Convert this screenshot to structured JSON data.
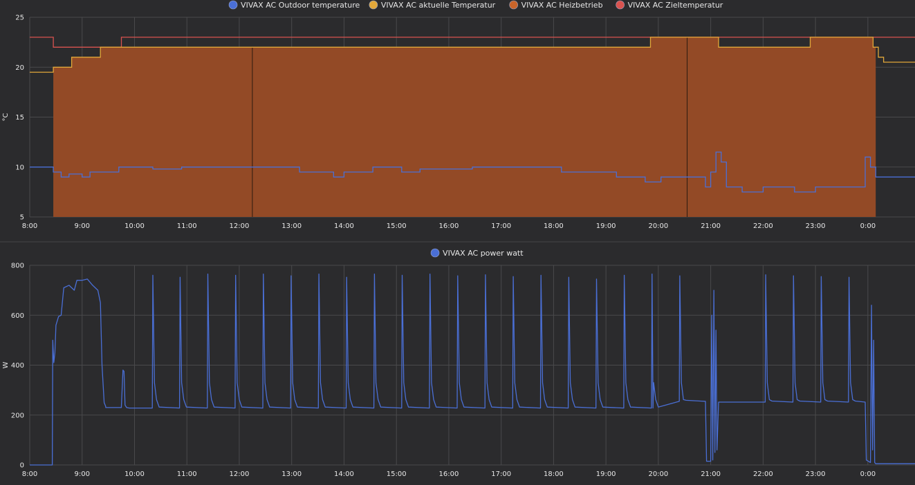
{
  "colors": {
    "outdoor": "#4a6fd6",
    "current": "#e2a83a",
    "heating_fill": "#934a26",
    "heating_line": "#c8642a",
    "target": "#d9534f",
    "power": "#4a6fd6",
    "grid": "#4a4a4c",
    "background": "#2b2b2d",
    "divider": "#444446"
  },
  "x_ticks": [
    "8:00",
    "9:00",
    "10:00",
    "11:00",
    "12:00",
    "13:00",
    "14:00",
    "15:00",
    "16:00",
    "17:00",
    "18:00",
    "19:00",
    "20:00",
    "21:00",
    "22:00",
    "23:00",
    "0:00"
  ],
  "chart_data": [
    {
      "type": "line",
      "ylabel": "°C",
      "ylim": [
        5,
        25
      ],
      "yticks": [
        5,
        10,
        15,
        20,
        25
      ],
      "x_range_hours": [
        8,
        24.9
      ],
      "grid": true,
      "legend_position": "top-center",
      "series": [
        {
          "name": "VIVAX AC Outdoor temperature",
          "key": "outdoor",
          "x": [
            8.0,
            8.45,
            8.45,
            8.6,
            8.6,
            8.75,
            8.75,
            9.0,
            9.0,
            9.15,
            9.15,
            9.45,
            9.45,
            9.7,
            9.7,
            10.35,
            10.35,
            10.9,
            10.9,
            12.25,
            12.25,
            13.15,
            13.15,
            13.8,
            13.8,
            14.0,
            14.0,
            14.55,
            14.55,
            15.1,
            15.1,
            15.45,
            15.45,
            16.45,
            16.45,
            17.4,
            17.4,
            18.15,
            18.15,
            19.2,
            19.2,
            19.75,
            19.75,
            20.05,
            20.05,
            20.9,
            20.9,
            21.0,
            21.0,
            21.1,
            21.1,
            21.2,
            21.2,
            21.3,
            21.3,
            21.6,
            21.6,
            22.0,
            22.0,
            22.15,
            22.15,
            22.6,
            22.6,
            23.0,
            23.0,
            23.4,
            23.4,
            23.95,
            23.95,
            24.05,
            24.05,
            24.15,
            24.15,
            24.9
          ],
          "y": [
            10.0,
            10.0,
            9.5,
            9.5,
            9.0,
            9.0,
            9.3,
            9.3,
            9.0,
            9.0,
            9.5,
            9.5,
            9.5,
            9.5,
            10.0,
            10.0,
            9.8,
            9.8,
            10.0,
            10.0,
            10.0,
            10.0,
            9.5,
            9.5,
            9.0,
            9.0,
            9.5,
            9.5,
            10.0,
            10.0,
            9.5,
            9.5,
            9.8,
            9.8,
            10.0,
            10.0,
            10.0,
            10.0,
            9.5,
            9.5,
            9.0,
            9.0,
            8.5,
            8.5,
            9.0,
            9.0,
            8.0,
            8.0,
            9.5,
            9.5,
            11.5,
            11.5,
            10.5,
            10.5,
            8.0,
            8.0,
            7.5,
            7.5,
            8.0,
            8.0,
            8.0,
            8.0,
            7.5,
            7.5,
            8.0,
            8.0,
            8.0,
            8.0,
            11.0,
            11.0,
            10.0,
            10.0,
            9.0,
            9.0
          ]
        },
        {
          "name": "VIVAX AC aktuelle Temperatur",
          "key": "current",
          "x": [
            8.0,
            8.45,
            8.45,
            8.8,
            8.8,
            9.35,
            9.35,
            12.25,
            12.25,
            19.85,
            19.85,
            20.9,
            20.9,
            21.15,
            21.15,
            22.9,
            22.9,
            24.1,
            24.1,
            24.2,
            24.2,
            24.3,
            24.3,
            24.9
          ],
          "y": [
            19.5,
            19.5,
            20.0,
            20.0,
            21.0,
            21.0,
            22.0,
            22.0,
            22.0,
            22.0,
            23.0,
            23.0,
            23.0,
            23.0,
            22.0,
            22.0,
            23.0,
            23.0,
            22.0,
            22.0,
            21.0,
            21.0,
            20.5,
            20.5
          ]
        },
        {
          "name": "VIVAX AC Heizbetrieb",
          "key": "heating",
          "fill": true,
          "x": [
            8.45,
            12.25,
            12.25,
            20.55,
            20.55,
            24.15
          ],
          "y": [
            1,
            1,
            1,
            1,
            1,
            1
          ]
        },
        {
          "name": "VIVAX AC Zieltemperatur",
          "key": "target",
          "x": [
            8.0,
            8.45,
            8.45,
            9.75,
            9.75,
            24.9
          ],
          "y": [
            23.0,
            23.0,
            22.0,
            22.0,
            23.0,
            23.0
          ]
        }
      ]
    },
    {
      "type": "line",
      "ylabel": "W",
      "ylim": [
        0,
        800
      ],
      "yticks": [
        0,
        200,
        400,
        600,
        800
      ],
      "x_range_hours": [
        8,
        24.9
      ],
      "grid": true,
      "legend_position": "top-center",
      "series": [
        {
          "name": "VIVAX AC power watt",
          "key": "power",
          "baseline_segments": [
            {
              "x0": 9.45,
              "x1": 9.75,
              "y": 230
            },
            {
              "x0": 9.9,
              "x1": 19.9,
              "y": 228
            },
            {
              "x0": 19.9,
              "x1": 20.9,
              "y": 255
            },
            {
              "x0": 21.15,
              "x1": 23.95,
              "y": 252
            }
          ],
          "spikes_x": [
            10.35,
            10.87,
            11.4,
            11.93,
            12.46,
            12.99,
            13.52,
            14.05,
            14.58,
            15.11,
            15.64,
            16.17,
            16.7,
            17.23,
            17.76,
            18.29,
            18.82,
            19.35,
            19.88,
            20.41,
            22.05,
            22.58,
            23.11,
            23.64
          ],
          "spikes_y": [
            760,
            752,
            765,
            760,
            765,
            758,
            765,
            752,
            765,
            760,
            765,
            758,
            762,
            755,
            760,
            752,
            745,
            760,
            765,
            758,
            762,
            758,
            755,
            752
          ],
          "events_x": [
            8.0,
            8.43,
            8.44,
            8.46,
            8.48,
            8.5,
            8.55,
            8.6,
            8.65,
            8.75,
            8.85,
            8.9,
            9.0,
            9.1,
            9.2,
            9.3,
            9.35,
            9.38,
            9.42,
            9.45,
            9.75,
            9.78,
            9.8,
            9.82,
            9.85,
            9.9,
            20.9,
            20.92,
            21.0,
            21.02,
            21.04,
            21.06,
            21.08,
            21.1,
            21.12,
            21.15,
            23.95,
            23.97,
            24.05,
            24.07,
            24.09,
            24.11,
            24.13,
            24.15,
            24.9
          ],
          "events_y": [
            0,
            0,
            500,
            410,
            450,
            560,
            595,
            600,
            710,
            720,
            700,
            740,
            740,
            745,
            720,
            700,
            650,
            400,
            250,
            235,
            235,
            380,
            375,
            240,
            230,
            228,
            255,
            15,
            15,
            600,
            20,
            700,
            50,
            540,
            60,
            252,
            252,
            20,
            10,
            640,
            60,
            500,
            10,
            5,
            5
          ]
        }
      ]
    }
  ]
}
